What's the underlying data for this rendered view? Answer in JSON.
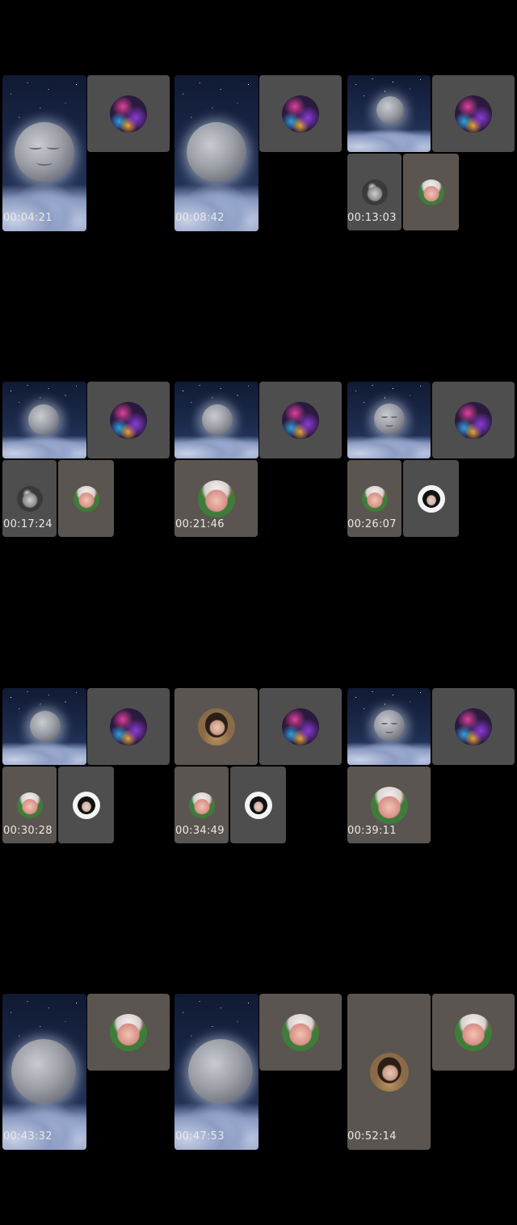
{
  "screenshots": [
    {
      "timestamp": "00:04:21"
    },
    {
      "timestamp": "00:08:42"
    },
    {
      "timestamp": "00:13:03"
    },
    {
      "timestamp": "00:17:24"
    },
    {
      "timestamp": "00:21:46"
    },
    {
      "timestamp": "00:26:07"
    },
    {
      "timestamp": "00:30:28"
    },
    {
      "timestamp": "00:34:49"
    },
    {
      "timestamp": "00:39:11"
    },
    {
      "timestamp": "00:43:32"
    },
    {
      "timestamp": "00:47:53"
    },
    {
      "timestamp": "00:52:14"
    }
  ]
}
